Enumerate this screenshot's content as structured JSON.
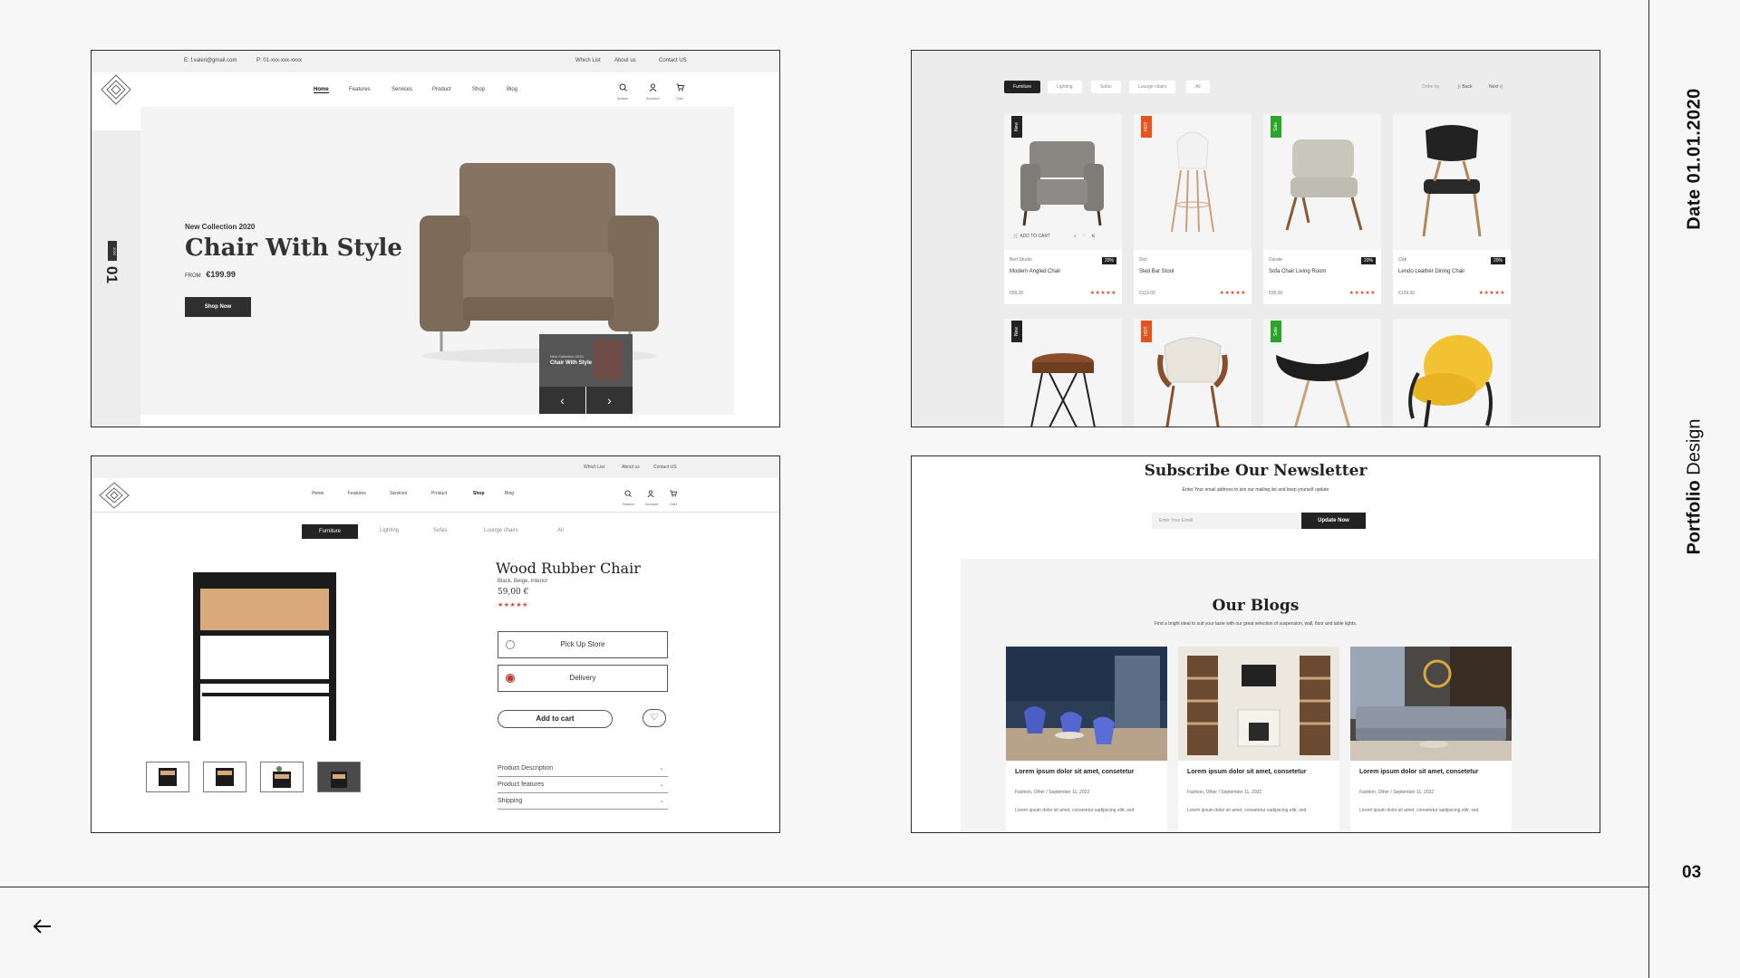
{
  "side": {
    "date": "Date 01.01.2020",
    "portfolio_bold": "Portfolio",
    "portfolio_rest": " Design",
    "page_number": "03"
  },
  "hero": {
    "email": "E: f.valeri@gmail.com",
    "phone": "P: 01-xxx-xxx-xxxx",
    "wishlist": "Which List",
    "about": "About us",
    "contact": "Contact US",
    "nav": [
      "Home",
      "Features",
      "Services",
      "Product",
      "Shop",
      "Blog"
    ],
    "icons": [
      "Search",
      "Account",
      "Cart"
    ],
    "slide_num": "01",
    "slide_tag": "2020",
    "kicker": "New Collection 2020",
    "title": "Chair With Style",
    "from_label": "FROM",
    "price": "€199.99",
    "cta": "Shop Now",
    "mini_kicker": "New Collection 2020",
    "mini_title": "Chair With Style"
  },
  "grid": {
    "tabs": [
      "Furniture",
      "Lighting",
      "Sofas",
      "Lounge chairs",
      "All"
    ],
    "order_by": "Order by",
    "back": "Back",
    "next": "Next",
    "add_to_cart": "ADD TO CART",
    "cards": [
      {
        "badge": "New",
        "badge_color": "#222222",
        "brand": "Bert Studio",
        "name": "Modern Angled Chair",
        "price": "€99.00",
        "discount": "20%"
      },
      {
        "badge": "HOT",
        "badge_color": "#e8531c",
        "brand": "Stol",
        "name": "Sled Bar Stool",
        "price": "€119.00",
        "discount": ""
      },
      {
        "badge": "Sale",
        "badge_color": "#2aa52a",
        "brand": "Durate",
        "name": "Sofa Chair Living Room",
        "price": "€99.00",
        "discount": "20%"
      },
      {
        "badge": "",
        "badge_color": "#222222",
        "brand": "Oak",
        "name": "Lendo Leather Dining Chair",
        "price": "€139.00",
        "discount": "20%"
      }
    ],
    "row2_badges": [
      {
        "badge": "New",
        "badge_color": "#222222"
      },
      {
        "badge": "HOT",
        "badge_color": "#e8531c"
      },
      {
        "badge": "Sale",
        "badge_color": "#2aa52a"
      }
    ]
  },
  "product": {
    "top_links": [
      "Which List",
      "About us",
      "Contact US"
    ],
    "nav": [
      "Home",
      "Features",
      "Services",
      "Product",
      "Shop",
      "Blog"
    ],
    "icons": [
      "Search",
      "Account",
      "Cart"
    ],
    "tabs": [
      "Furniture",
      "Lighting",
      "Sofas",
      "Lounge chairs",
      "All"
    ],
    "title": "Wood Rubber Chair",
    "colors": "Black, Beige, Interior",
    "price": "59,00 €",
    "option_pickup": "Pick Up Store",
    "option_delivery": "Delivery",
    "add_to_cart": "Add to cart",
    "accordion": [
      "Product Description",
      "Product features",
      "Shipping"
    ]
  },
  "newsletter": {
    "title": "Subscribe Our Newsletter",
    "subtitle": "Enter Your email address to join our mailing list and keep yourself update",
    "email_placeholder": "Enter Your Email",
    "button": "Update Now",
    "blogs_title": "Our Blogs",
    "blogs_subtitle": "Find a bright ideal to suit your taste with our great selection of suspension, wall, floor and table lights.",
    "post_title": "Lorem ipsum dolor sit amet, consetetur",
    "post_meta": "Fashion, Other   /   September 11, 2022",
    "post_excerpt": "Lorem ipsum dolor sit amet, consetetur sadipscing elitr, sed"
  }
}
